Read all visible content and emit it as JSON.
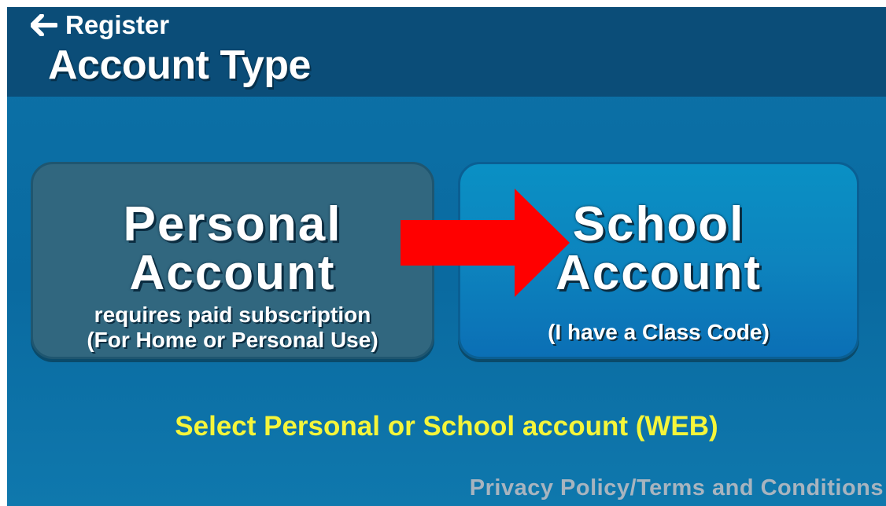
{
  "header": {
    "back_label": "Register",
    "back_icon": "arrow-left-icon",
    "title": "Account Type"
  },
  "cards": {
    "personal": {
      "title_line1": "Personal",
      "title_line2": "Account",
      "subtitle_line1": "requires paid subscription",
      "subtitle_line2": "(For Home or Personal Use)"
    },
    "school": {
      "title_line1": "School",
      "title_line2": "Account",
      "subtitle": "(I have a Class Code)"
    }
  },
  "annotation": {
    "arrow_icon": "red-arrow-right-icon",
    "arrow_color": "#ff0000"
  },
  "instruction": "Select Personal or School account (WEB)",
  "footer": {
    "privacy_link": "Privacy Policy/Terms and Conditions"
  },
  "colors": {
    "header_bg": "#0b4d78",
    "page_bg": "#0c72a8",
    "personal_card_bg": "#31677f",
    "school_card_bg": "#0a90c4",
    "instruction_text": "#f5f53a",
    "footer_text": "#a8b4bf"
  }
}
